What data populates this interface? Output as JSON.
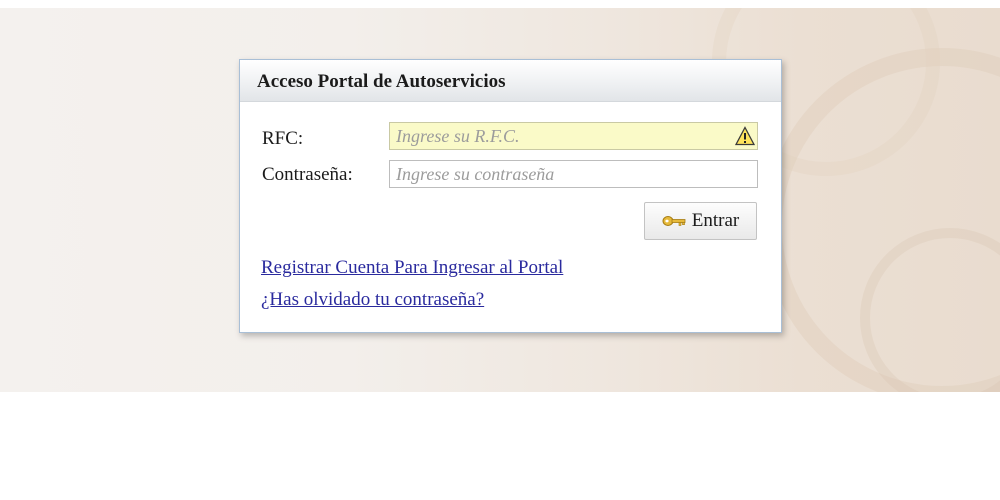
{
  "login": {
    "title": "Acceso Portal de Autoservicios",
    "rfc_label": "RFC:",
    "rfc_placeholder": "Ingrese su R.F.C.",
    "rfc_value": "",
    "password_label": "Contraseña:",
    "password_placeholder": "Ingrese su contraseña",
    "password_value": "",
    "submit_label": "Entrar",
    "register_link": "Registrar Cuenta Para Ingresar al Portal",
    "forgot_link": "¿Has olvidado tu contraseña?"
  },
  "icons": {
    "rfc_warning": "warning-icon",
    "submit": "key-icon"
  },
  "colors": {
    "rfc_field_bg": "#fafac8",
    "link": "#2a2a9e",
    "box_border": "#a9bfd6"
  }
}
